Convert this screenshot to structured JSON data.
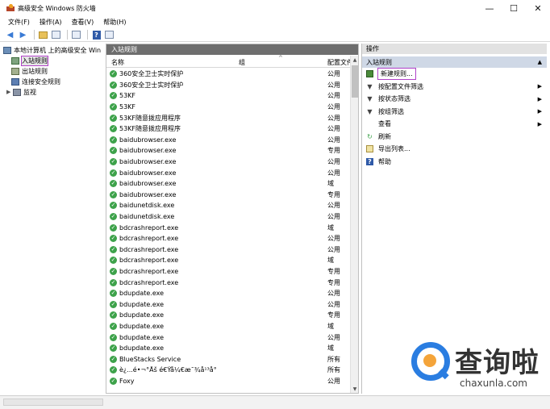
{
  "window": {
    "title": "高级安全 Windows 防火墙",
    "min": "—",
    "max": "☐",
    "close": "✕"
  },
  "menu": [
    "文件(F)",
    "操作(A)",
    "查看(V)",
    "帮助(H)"
  ],
  "tree": {
    "root": "本地计算机 上的高级安全 Win",
    "items": [
      "入站规则",
      "出站规则",
      "连接安全规则",
      "监视"
    ]
  },
  "center": {
    "title": "入站规则",
    "columns": {
      "name": "名称",
      "group": "组",
      "profile": "配置文件"
    },
    "rows": [
      {
        "name": "360安全卫士实时保护",
        "profile": "公用"
      },
      {
        "name": "360安全卫士实时保护",
        "profile": "公用"
      },
      {
        "name": "53KF",
        "profile": "公用"
      },
      {
        "name": "53KF",
        "profile": "公用"
      },
      {
        "name": "53KF随意拨应用程序",
        "profile": "公用"
      },
      {
        "name": "53KF随意拨应用程序",
        "profile": "公用"
      },
      {
        "name": "baidubrowser.exe",
        "profile": "公用"
      },
      {
        "name": "baidubrowser.exe",
        "profile": "专用"
      },
      {
        "name": "baidubrowser.exe",
        "profile": "公用"
      },
      {
        "name": "baidubrowser.exe",
        "profile": "公用"
      },
      {
        "name": "baidubrowser.exe",
        "profile": "域"
      },
      {
        "name": "baidubrowser.exe",
        "profile": "专用"
      },
      {
        "name": "baidunetdisk.exe",
        "profile": "公用"
      },
      {
        "name": "baidunetdisk.exe",
        "profile": "公用"
      },
      {
        "name": "bdcrashreport.exe",
        "profile": "域"
      },
      {
        "name": "bdcrashreport.exe",
        "profile": "公用"
      },
      {
        "name": "bdcrashreport.exe",
        "profile": "公用"
      },
      {
        "name": "bdcrashreport.exe",
        "profile": "域"
      },
      {
        "name": "bdcrashreport.exe",
        "profile": "专用"
      },
      {
        "name": "bdcrashreport.exe",
        "profile": "专用"
      },
      {
        "name": "bdupdate.exe",
        "profile": "公用"
      },
      {
        "name": "bdupdate.exe",
        "profile": "公用"
      },
      {
        "name": "bdupdate.exe",
        "profile": "专用"
      },
      {
        "name": "bdupdate.exe",
        "profile": "域"
      },
      {
        "name": "bdupdate.exe",
        "profile": "公用"
      },
      {
        "name": "bdupdate.exe",
        "profile": "域"
      },
      {
        "name": "BlueStacks Service",
        "profile": "所有"
      },
      {
        "name": "è¿...é•¬°Åš é€Ÿå¼€æ¯¾å¹³å°",
        "profile": "所有"
      },
      {
        "name": "Foxy",
        "profile": "公用"
      }
    ]
  },
  "actions": {
    "title": "操作",
    "section": "入站规则",
    "items": [
      "新建规则...",
      "按配置文件筛选",
      "按状态筛选",
      "按组筛选",
      "查看",
      "刷新",
      "导出列表...",
      "帮助"
    ]
  },
  "watermark": {
    "text": "查询啦",
    "sub": "chaxunla.com"
  }
}
